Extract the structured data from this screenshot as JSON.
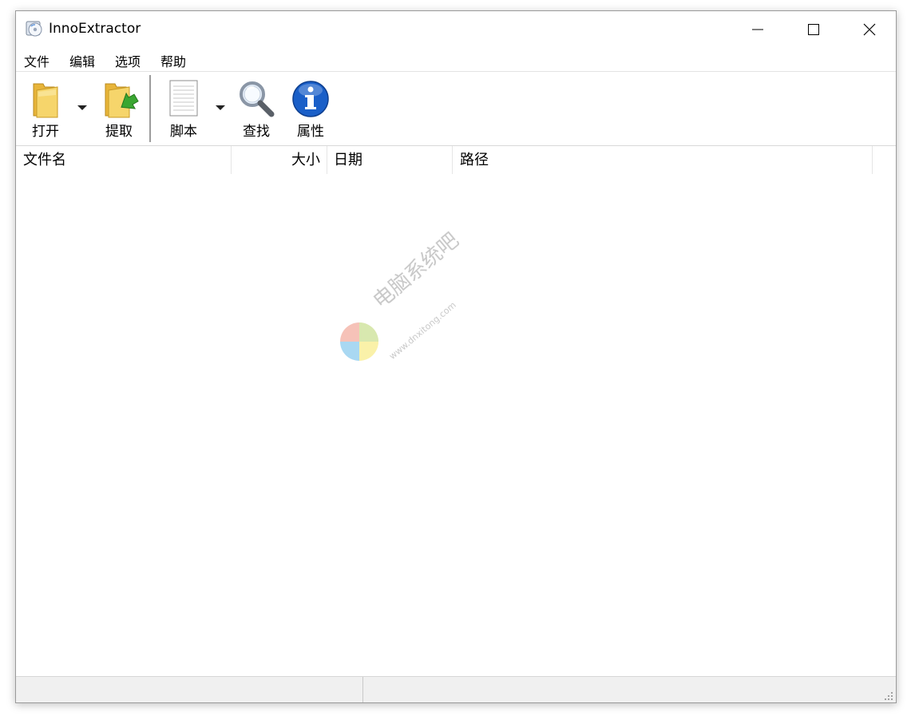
{
  "window": {
    "title": "InnoExtractor",
    "icon": "disc-icon",
    "controls": {
      "minimize": "minimize-icon",
      "maximize": "maximize-icon",
      "close": "close-icon"
    }
  },
  "menu": {
    "items": [
      {
        "label": "文件"
      },
      {
        "label": "编辑"
      },
      {
        "label": "选项"
      },
      {
        "label": "帮助"
      }
    ]
  },
  "toolbar": {
    "open": {
      "label": "打开",
      "icon": "folder-icon"
    },
    "extract": {
      "label": "提取",
      "icon": "folder-extract-icon"
    },
    "script": {
      "label": "脚本",
      "icon": "document-icon"
    },
    "find": {
      "label": "查找",
      "icon": "magnifier-icon"
    },
    "properties": {
      "label": "属性",
      "icon": "info-icon"
    }
  },
  "list": {
    "columns": [
      {
        "label": "文件名"
      },
      {
        "label": "大小"
      },
      {
        "label": "日期"
      },
      {
        "label": "路径"
      }
    ],
    "rows": []
  },
  "statusbar": {
    "left_text": "",
    "right_text": ""
  },
  "watermark": {
    "text": "电脑系统吧",
    "url": "www.dnxitong.com"
  },
  "colors": {
    "info_blue": "#1a5fc8",
    "folder_yellow": "#f2c84b",
    "extract_green": "#3aa631"
  }
}
